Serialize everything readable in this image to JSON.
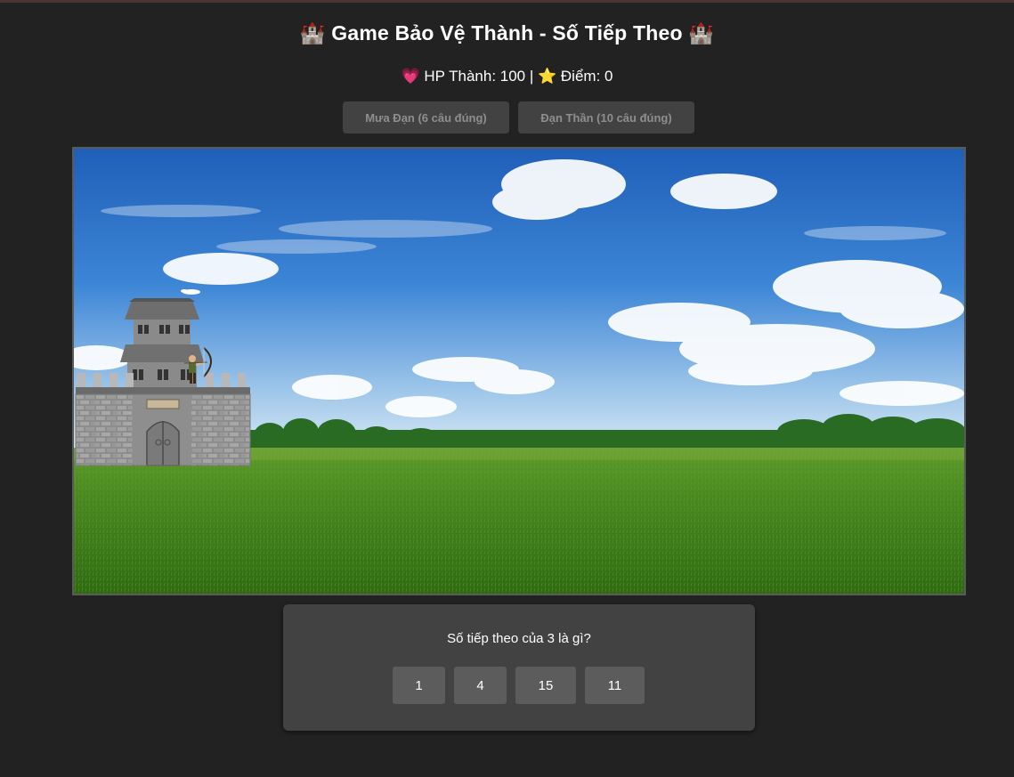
{
  "header": {
    "title": "🏰 Game Bảo Vệ Thành - Số Tiếp Theo 🏰",
    "status": {
      "hp_icon": "heart-icon",
      "hp_label": "💗 HP Thành: 100 |",
      "score_icon": "star-icon",
      "score_label": "⭐ Điểm: 0"
    }
  },
  "powerups": [
    {
      "label": "Mưa Đạn (6 câu đúng)",
      "enabled": false
    },
    {
      "label": "Đạn Thần (10 câu đúng)",
      "enabled": false
    }
  ],
  "game": {
    "castle_hp": 100,
    "score": 0
  },
  "quiz": {
    "question": "Số tiếp theo của 3 là gì?",
    "answers": [
      "1",
      "4",
      "15",
      "11"
    ]
  },
  "colors": {
    "background": "#222222",
    "panel": "#424242",
    "answer_button": "#5c5c5c",
    "disabled_text": "#8e8e8e"
  }
}
